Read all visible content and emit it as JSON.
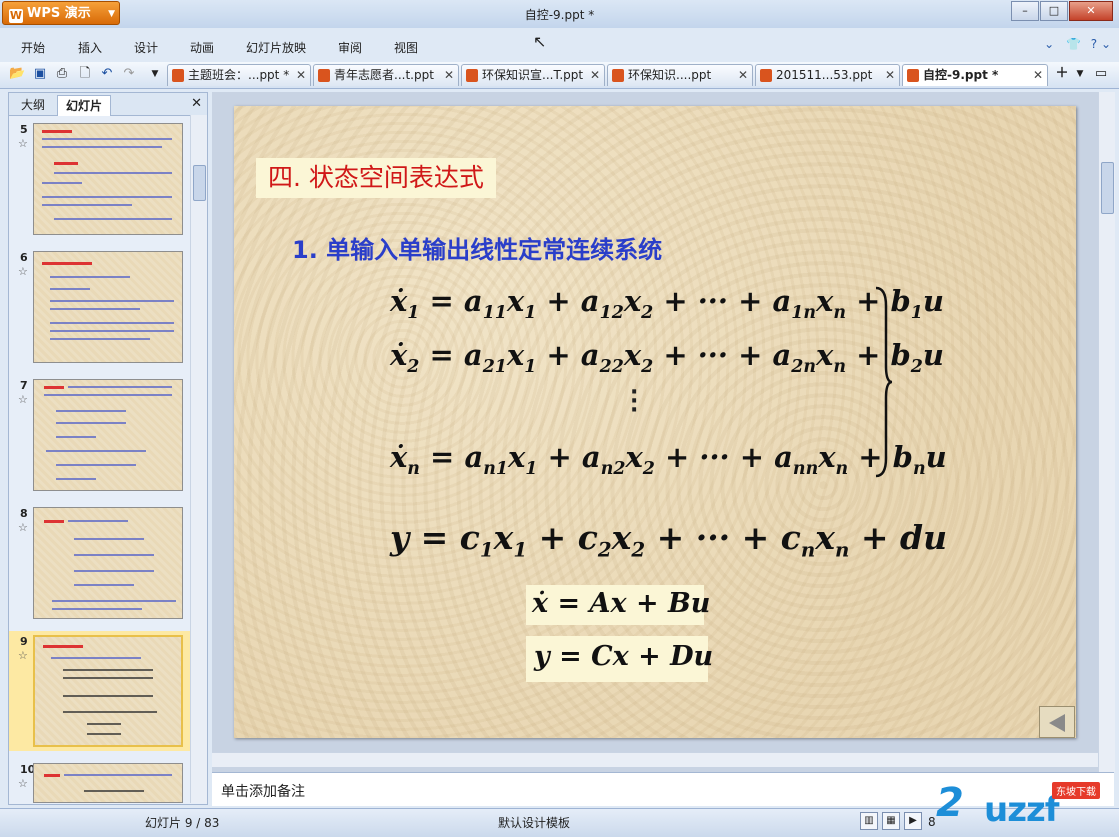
{
  "app": {
    "name": "WPS 演示",
    "window_title": "自控-9.ppt *"
  },
  "menu": [
    "开始",
    "插入",
    "设计",
    "动画",
    "幻灯片放映",
    "审阅",
    "视图"
  ],
  "tabs": [
    {
      "label": "主题班会：...ppt *",
      "active": false
    },
    {
      "label": "青年志愿者...t.ppt",
      "active": false
    },
    {
      "label": "环保知识宣...T.ppt",
      "active": false
    },
    {
      "label": "环保知识....ppt",
      "active": false
    },
    {
      "label": "201511...53.ppt",
      "active": false
    },
    {
      "label": "自控-9.ppt *",
      "active": true
    }
  ],
  "left_panel": {
    "tab_outline": "大纲",
    "tab_slides": "幻灯片",
    "thumbnails": [
      {
        "num": "5",
        "selected": false
      },
      {
        "num": "6",
        "selected": false
      },
      {
        "num": "7",
        "selected": false
      },
      {
        "num": "8",
        "selected": false
      },
      {
        "num": "9",
        "selected": true
      },
      {
        "num": "10",
        "selected": false
      }
    ]
  },
  "slide": {
    "section_title": "四. 状态空间表达式",
    "subtitle": "1. 单输入单输出线性定常连续系统",
    "colors": {
      "section_title": "#d01818",
      "subtitle": "#2a3ec9",
      "highlight_box": "#fbf6d6"
    }
  },
  "notes_placeholder": "单击添加备注",
  "status": {
    "slide_info": "幻灯片 9 / 83",
    "template": "默认设计模板",
    "zoom": "8"
  },
  "watermark": {
    "logo": "uzzf.com",
    "badge": "东坡下载"
  }
}
